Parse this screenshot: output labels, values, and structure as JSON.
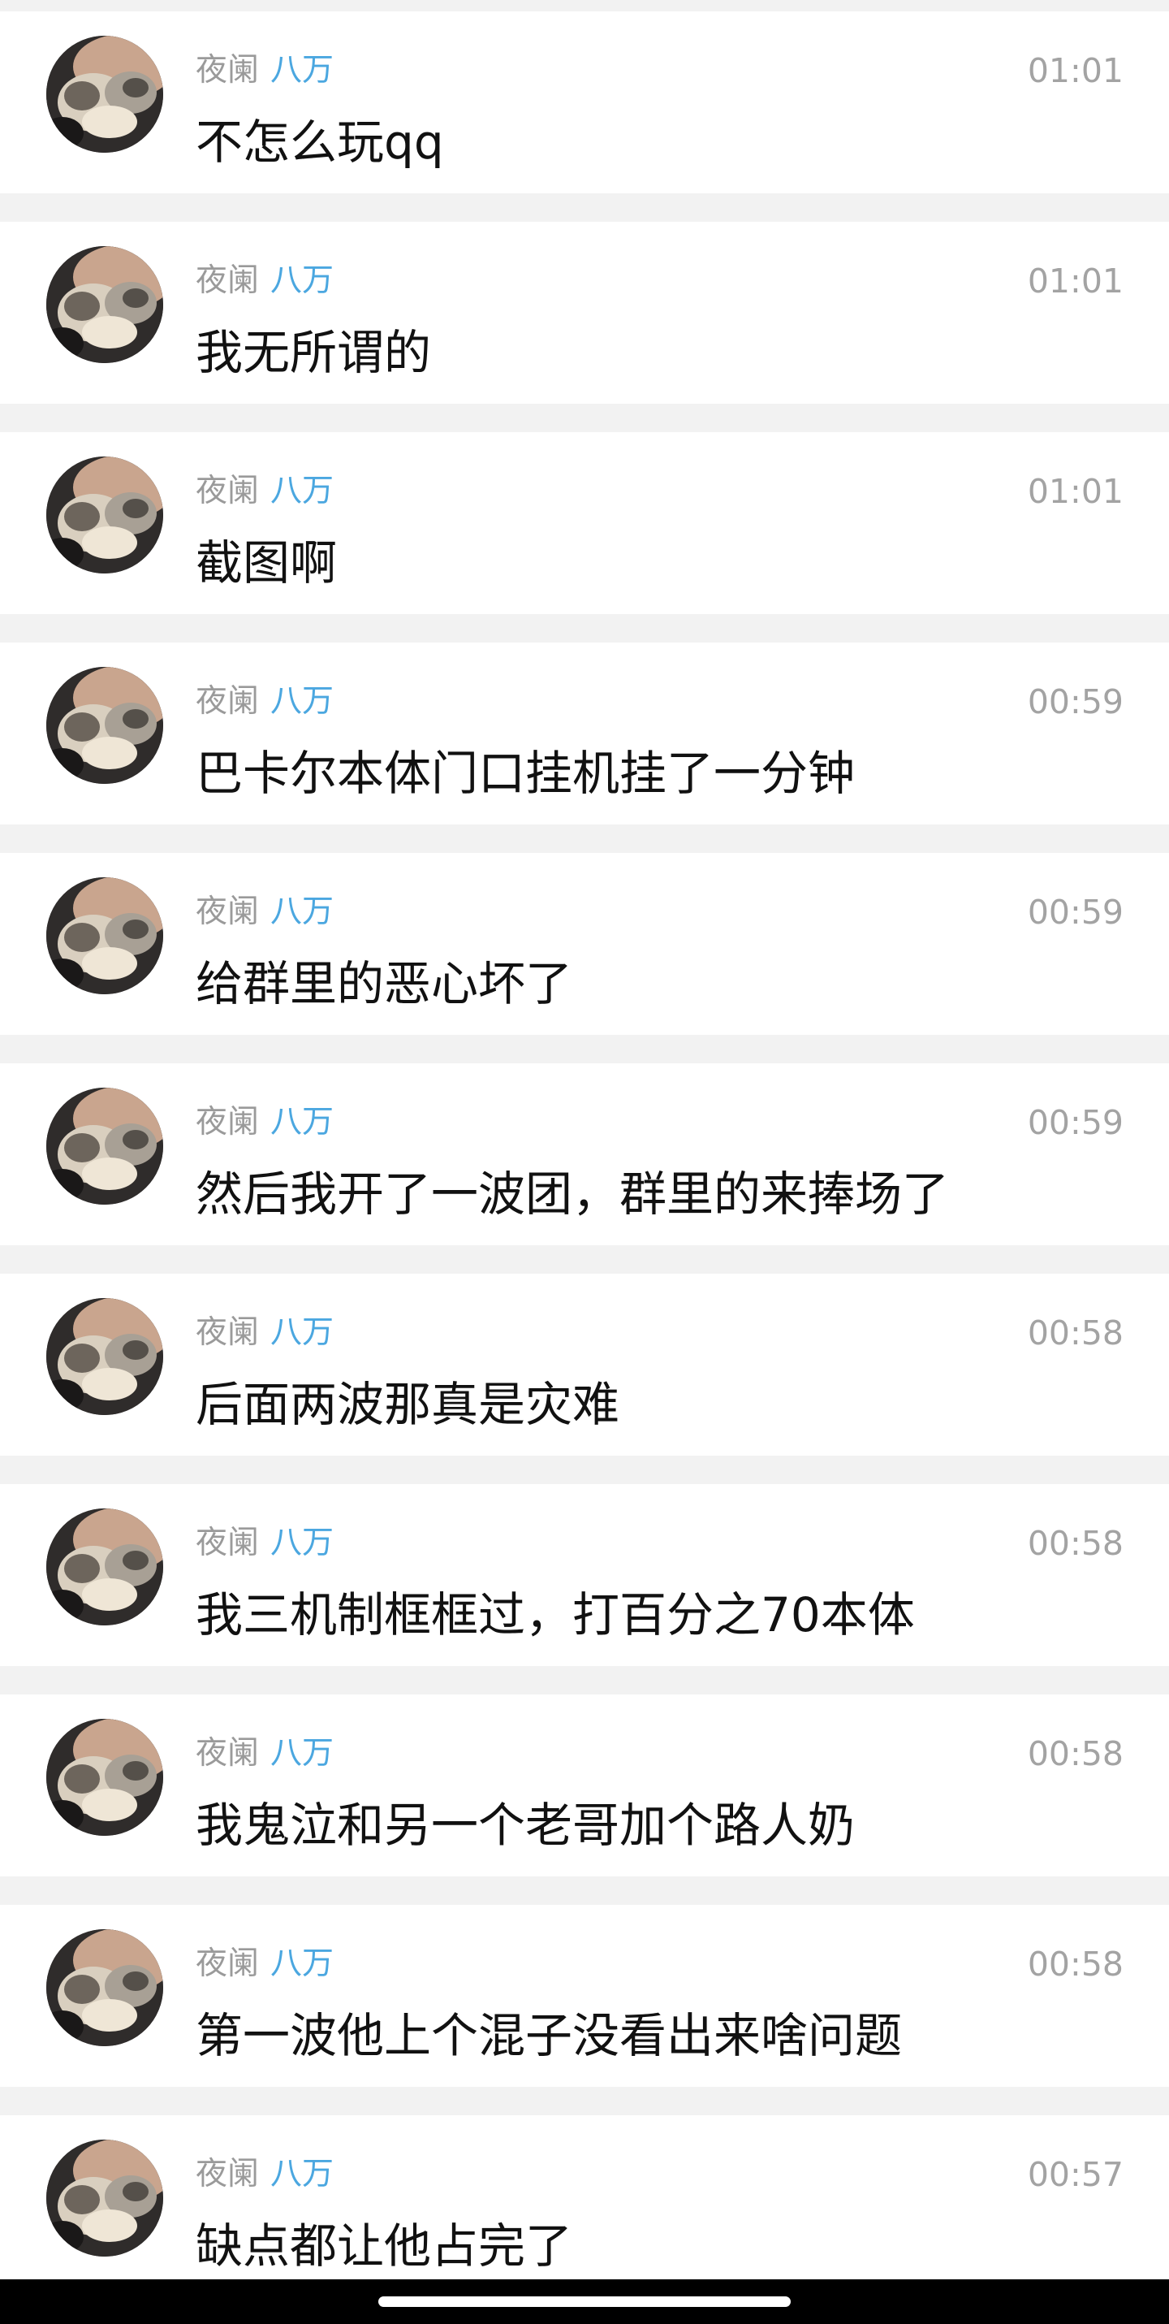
{
  "messages": [
    {
      "sender": "夜阑",
      "role": "八万",
      "time": "01:01",
      "text": "不怎么玩qq"
    },
    {
      "sender": "夜阑",
      "role": "八万",
      "time": "01:01",
      "text": "我无所谓的"
    },
    {
      "sender": "夜阑",
      "role": "八万",
      "time": "01:01",
      "text": "截图啊"
    },
    {
      "sender": "夜阑",
      "role": "八万",
      "time": "00:59",
      "text": "巴卡尔本体门口挂机挂了一分钟"
    },
    {
      "sender": "夜阑",
      "role": "八万",
      "time": "00:59",
      "text": "给群里的恶心坏了"
    },
    {
      "sender": "夜阑",
      "role": "八万",
      "time": "00:59",
      "text": "然后我开了一波团，群里的来捧场了"
    },
    {
      "sender": "夜阑",
      "role": "八万",
      "time": "00:58",
      "text": "后面两波那真是灾难"
    },
    {
      "sender": "夜阑",
      "role": "八万",
      "time": "00:58",
      "text": "我三机制框框过，打百分之70本体"
    },
    {
      "sender": "夜阑",
      "role": "八万",
      "time": "00:58",
      "text": "我鬼泣和另一个老哥加个路人奶"
    },
    {
      "sender": "夜阑",
      "role": "八万",
      "time": "00:58",
      "text": "第一波他上个混子没看出来啥问题"
    },
    {
      "sender": "夜阑",
      "role": "八万",
      "time": "00:57",
      "text": "缺点都让他占完了"
    }
  ],
  "colors": {
    "background": "#f2f2f2",
    "card": "#ffffff",
    "sender": "#9a9a9a",
    "role": "#4ba7e0",
    "time": "#a3a3a3",
    "text": "#111111"
  },
  "icons": {
    "avatar": "cat-avatar-icon",
    "home": "home-indicator"
  }
}
